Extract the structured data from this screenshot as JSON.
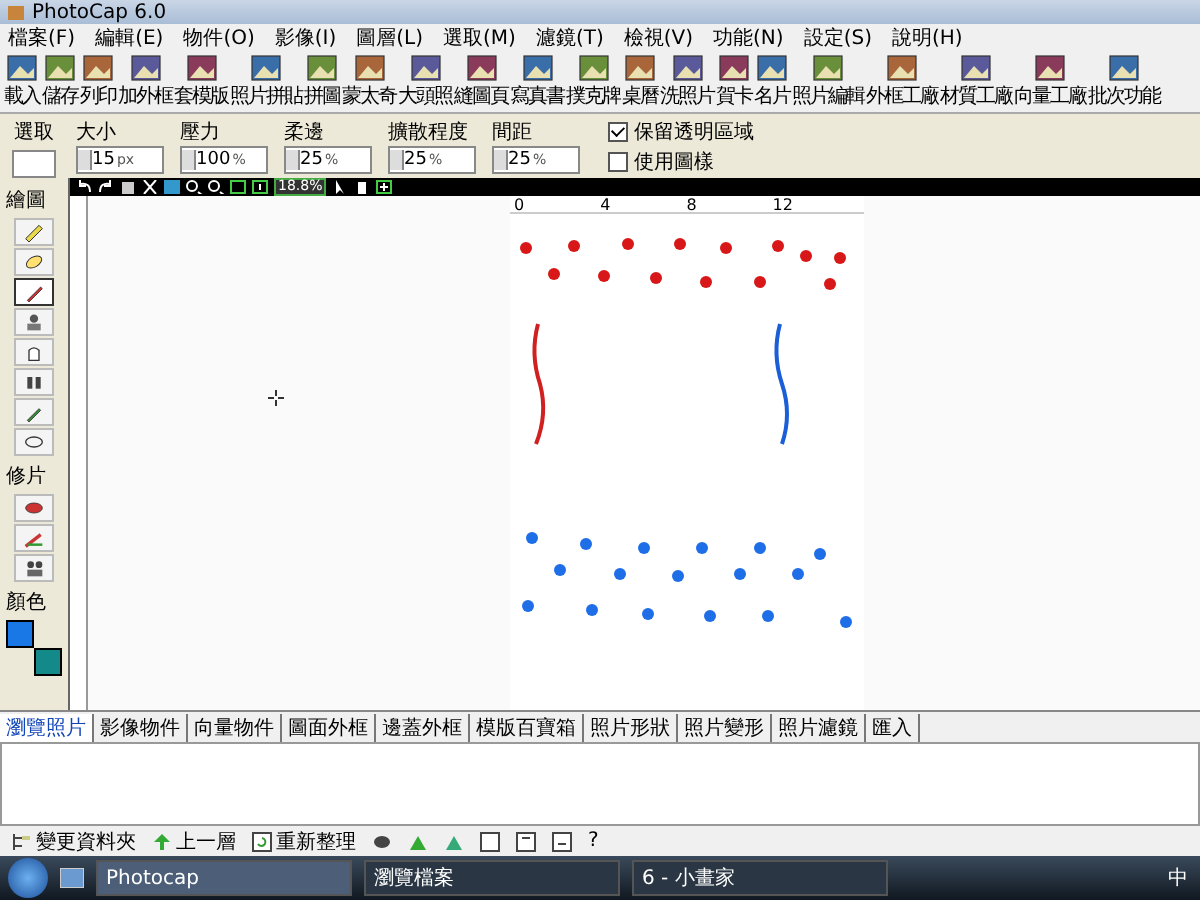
{
  "window": {
    "title": "PhotoCap 6.0"
  },
  "menu": [
    "檔案(F)",
    "編輯(E)",
    "物件(O)",
    "影像(I)",
    "圖層(L)",
    "選取(M)",
    "濾鏡(T)",
    "檢視(V)",
    "功能(N)",
    "設定(S)",
    "說明(H)"
  ],
  "toolbar": [
    "載入",
    "儲存",
    "列印",
    "加外框",
    "套模版",
    "照片拼貼",
    "拼圖",
    "蒙太奇",
    "大頭照",
    "縫圖頁",
    "寫真書",
    "撲克牌",
    "桌曆",
    "洗照片",
    "賀卡",
    "名片",
    "照片編輯",
    "外框工廠",
    "材質工廠",
    "向量工廠",
    "批次功能"
  ],
  "brush_options": [
    {
      "label": "大小",
      "value": "15",
      "unit": "px"
    },
    {
      "label": "壓力",
      "value": "100",
      "unit": "%"
    },
    {
      "label": "柔邊",
      "value": "25",
      "unit": "%"
    },
    {
      "label": "擴散程度",
      "value": "25",
      "unit": "%"
    },
    {
      "label": "間距",
      "value": "25",
      "unit": "%"
    }
  ],
  "checkboxes": [
    {
      "label": "保留透明區域",
      "checked": true
    },
    {
      "label": "使用圖樣",
      "checked": false
    }
  ],
  "canvas_toolbar": {
    "zoom": "18.8%"
  },
  "ruler": [
    "0",
    "4",
    "8",
    "12"
  ],
  "tool_sections": [
    "選取",
    "繪圖",
    "修片",
    "顏色"
  ],
  "drawing_tools": [
    {
      "selected": false
    },
    {
      "selected": false
    },
    {
      "selected": true
    },
    {
      "selected": false
    },
    {
      "selected": false
    },
    {
      "selected": false
    },
    {
      "selected": false
    },
    {
      "selected": false
    }
  ],
  "bottom_tabs": [
    {
      "label": "瀏覽照片",
      "selected": true
    },
    {
      "label": "影像物件",
      "selected": false
    },
    {
      "label": "向量物件",
      "selected": false
    },
    {
      "label": "圖面外框",
      "selected": false
    },
    {
      "label": "邊蓋外框",
      "selected": false
    },
    {
      "label": "模版百寶箱",
      "selected": false
    },
    {
      "label": "照片形狀",
      "selected": false
    },
    {
      "label": "照片變形",
      "selected": false
    },
    {
      "label": "照片濾鏡",
      "selected": false
    },
    {
      "label": "匯入",
      "selected": false
    }
  ],
  "browser_toolbar": {
    "buttons": [
      "變更資料夾",
      "上一層",
      "重新整理"
    ],
    "help": "?"
  },
  "taskbar": {
    "items": [
      {
        "label": "Photocap",
        "selected": true
      },
      {
        "label": "瀏覽檔案",
        "selected": false
      },
      {
        "label": "6 - 小畫家",
        "selected": false
      }
    ],
    "tray": "中"
  }
}
